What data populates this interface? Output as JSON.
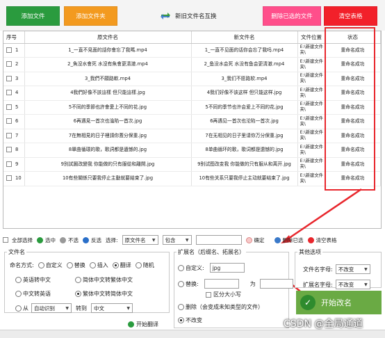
{
  "toolbar": {
    "add_file": "添加文件",
    "add_folder": "添加文件夹",
    "swap_names": "新旧文件名互换",
    "delete_selected_files": "删除已选的文件",
    "clear_table": "清空表格",
    "colors": {
      "add_file": "#2a9b3e",
      "add_folder": "#f39a1f",
      "delete_selected": "#ff4f8b",
      "clear": "#f2202a"
    }
  },
  "table": {
    "columns": [
      "序号",
      "原文件名",
      "新文件名",
      "文件位置",
      "状态"
    ],
    "rows": [
      {
        "seq": "1",
        "orig": "1_一直不見面的話你會忘了我嗎.mp4",
        "new": "1_一直不见面的话你会忘了我吗.mp4",
        "loc": "E:\\新建文件夹\\",
        "status": "重命名成功"
      },
      {
        "seq": "2",
        "orig": "2_魚沒水會死 水沒有魚會更清澈.mp4",
        "new": "2_鱼没水会死 水没有鱼会更清澈.mp4",
        "loc": "E:\\新建文件夹\\",
        "status": "重命名成功"
      },
      {
        "seq": "3",
        "orig": "3_我們不願路軟.mp4",
        "new": "3_我们不愿路软.mp4",
        "loc": "E:\\新建文件夹\\",
        "status": "重命名成功"
      },
      {
        "seq": "4",
        "orig": "4我們好像不該這樣 但只能這樣.jpg",
        "new": "4我们好像不该这样 但只能这样.jpg",
        "loc": "E:\\新建文件夹\\",
        "status": "重命名成功"
      },
      {
        "seq": "5",
        "orig": "5不同的季節也許會愛上不同的花.jpg",
        "new": "5不同的季节也许会爱上不同的花.jpg",
        "loc": "E:\\新建文件夹\\",
        "status": "重命名成功"
      },
      {
        "seq": "6",
        "orig": "6再遇見一首次也淪陷一首次.jpg",
        "new": "6再遇见一首次也沦陷一首次.jpg",
        "loc": "E:\\新建文件夹\\",
        "status": "重命名成功"
      },
      {
        "seq": "7",
        "orig": "7在無相見的日子裡請你蓋分保重.jpg",
        "new": "7在无相见的日子里请你万分保重.jpg",
        "loc": "E:\\新建文件夹\\",
        "status": "重命名成功"
      },
      {
        "seq": "8",
        "orig": "8單曲循環的歌，歌詞都是遺憾的.jpg",
        "new": "8单曲循环的歌，歌词都是遗憾的.jpg",
        "loc": "E:\\新建文件夹\\",
        "status": "重命名成功"
      },
      {
        "seq": "9",
        "orig": "9別試圖改變我 你能做的只有服從和離開.jpg",
        "new": "9别试图改变我 你能做的只有服从和离开.jpg",
        "loc": "E:\\新建文件夹\\",
        "status": "重命名成功"
      },
      {
        "seq": "10",
        "orig": "10有些關係只要我停止主動就要結束了.jpg",
        "new": "10有些关系只要我停止主动就要结束了.jpg",
        "loc": "E:\\新建文件夹\\",
        "status": "重命名成功"
      }
    ]
  },
  "controls": {
    "select_all": "全部选择",
    "select": "选中",
    "deselect": "不选",
    "invert": "反选",
    "choose_label": "选择:",
    "field_value": "原文件名",
    "match_value": "包含",
    "filter_value": "",
    "confirm": "确定",
    "delete_selected": "删除已选",
    "clear_table": "清空表格"
  },
  "filename_panel": {
    "title": "文件名",
    "method_label": "命名方式:",
    "methods": [
      "自定义",
      "替换",
      "插入",
      "翻译",
      "随机"
    ],
    "selected_method": "翻译",
    "translate_options": [
      "英语转中文",
      "简体中文转繁体中文",
      "中文转英语",
      "繁体中文转简体中文"
    ],
    "selected_translate": "繁体中文转简体中文",
    "from_label": "从",
    "from_value": "自动识别",
    "to_label": "转到",
    "to_value": "中文",
    "start_translate": "开始翻译"
  },
  "ext_panel": {
    "title": "扩展名（后缀名、拓展名）",
    "custom_label": "自定义:",
    "custom_value": "jpg",
    "replace_label": "替换:",
    "replace_from": "",
    "replace_as": "为",
    "replace_to": "",
    "case_sensitive": "区分大小写",
    "delete_label": "删除（会变成未知类型的文件）",
    "no_change": "不改变",
    "selected": "不改变"
  },
  "other_panel": {
    "title": "其他选项",
    "filename_case_label": "文件名字母:",
    "filename_case_value": "不改变",
    "ext_case_label": "扩展名字母:",
    "ext_case_value": "不改变"
  },
  "start": {
    "label": "开始改名"
  },
  "watermark": "CSDN @全局通道"
}
